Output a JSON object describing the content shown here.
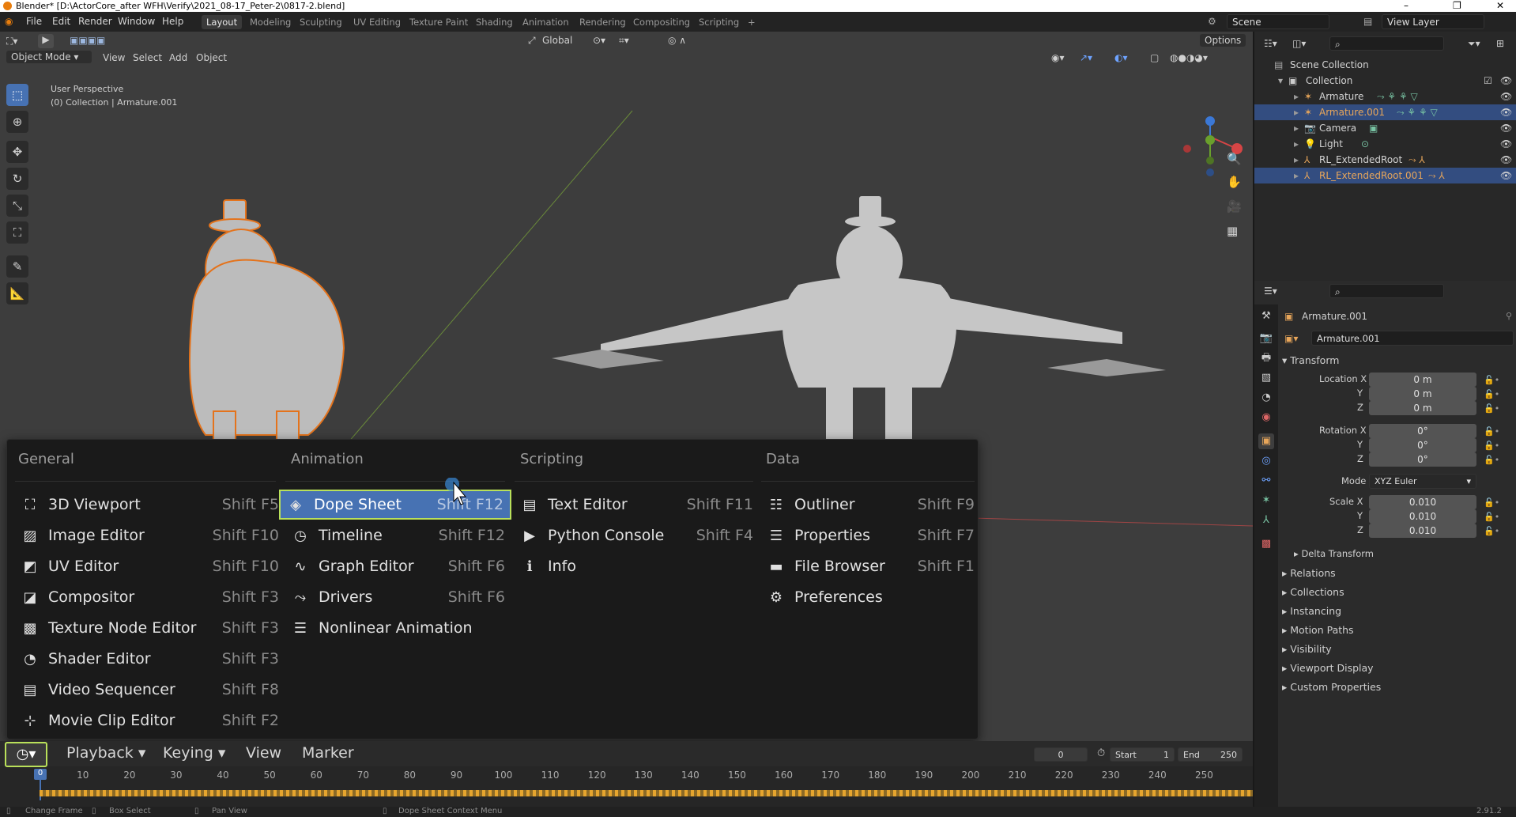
{
  "window": {
    "title": "Blender* [D:\\ActorCore_after WFH\\Verify\\2021_08-17_Peter-2\\0817-2.blend]",
    "controls": [
      "–",
      "❐",
      "✕"
    ]
  },
  "menubar": {
    "items": [
      "File",
      "Edit",
      "Render",
      "Window",
      "Help"
    ],
    "workspaces": [
      "Layout",
      "Modeling",
      "Sculpting",
      "UV Editing",
      "Texture Paint",
      "Shading",
      "Animation",
      "Rendering",
      "Compositing",
      "Scripting"
    ],
    "active_workspace": "Layout",
    "add_tab": "+",
    "scene": "Scene",
    "view_layer": "View Layer"
  },
  "viewport": {
    "mode": "Object Mode",
    "menu": [
      "View",
      "Select",
      "Add",
      "Object"
    ],
    "transform": "Global",
    "options": "Options",
    "perspective": "User Perspective",
    "context": "(0) Collection | Armature.001"
  },
  "editor_menu": {
    "columns": [
      {
        "heading": "General",
        "items": [
          {
            "label": "3D Viewport",
            "shortcut": "Shift F5",
            "icon": "viewport-icon"
          },
          {
            "label": "Image Editor",
            "shortcut": "Shift F10",
            "icon": "image-icon"
          },
          {
            "label": "UV Editor",
            "shortcut": "Shift F10",
            "icon": "uv-icon"
          },
          {
            "label": "Compositor",
            "shortcut": "Shift F3",
            "icon": "compositor-icon"
          },
          {
            "label": "Texture Node Editor",
            "shortcut": "Shift F3",
            "icon": "texture-icon"
          },
          {
            "label": "Shader Editor",
            "shortcut": "Shift F3",
            "icon": "shader-icon"
          },
          {
            "label": "Video Sequencer",
            "shortcut": "Shift F8",
            "icon": "sequencer-icon"
          },
          {
            "label": "Movie Clip Editor",
            "shortcut": "Shift F2",
            "icon": "clip-icon"
          }
        ]
      },
      {
        "heading": "Animation",
        "items": [
          {
            "label": "Dope Sheet",
            "shortcut": "Shift F12",
            "icon": "dopesheet-icon",
            "highlighted": true
          },
          {
            "label": "Timeline",
            "shortcut": "Shift F12",
            "icon": "timeline-icon"
          },
          {
            "label": "Graph Editor",
            "shortcut": "Shift F6",
            "icon": "graph-icon"
          },
          {
            "label": "Drivers",
            "shortcut": "Shift F6",
            "icon": "drivers-icon"
          },
          {
            "label": "Nonlinear Animation",
            "shortcut": "",
            "icon": "nla-icon"
          }
        ]
      },
      {
        "heading": "Scripting",
        "items": [
          {
            "label": "Text Editor",
            "shortcut": "Shift F11",
            "icon": "text-icon"
          },
          {
            "label": "Python Console",
            "shortcut": "Shift F4",
            "icon": "console-icon"
          },
          {
            "label": "Info",
            "shortcut": "",
            "icon": "info-icon"
          }
        ]
      },
      {
        "heading": "Data",
        "items": [
          {
            "label": "Outliner",
            "shortcut": "Shift F9",
            "icon": "outliner-icon"
          },
          {
            "label": "Properties",
            "shortcut": "Shift F7",
            "icon": "properties-icon"
          },
          {
            "label": "File Browser",
            "shortcut": "Shift F1",
            "icon": "folder-icon"
          },
          {
            "label": "Preferences",
            "shortcut": "",
            "icon": "gear-icon"
          }
        ]
      }
    ]
  },
  "timeline": {
    "menu": [
      "Playback",
      "Keying",
      "View",
      "Marker"
    ],
    "current_frame": "0",
    "start_label": "Start",
    "start": "1",
    "end_label": "End",
    "end": "250",
    "ticks": [
      "0",
      "10",
      "20",
      "30",
      "40",
      "50",
      "60",
      "70",
      "80",
      "90",
      "100",
      "110",
      "120",
      "130",
      "140",
      "150",
      "160",
      "170",
      "180",
      "190",
      "200",
      "210",
      "220",
      "230",
      "240",
      "250"
    ]
  },
  "statusbar": {
    "items": [
      "Change Frame",
      "Box Select",
      "Pan View",
      "Dope Sheet Context Menu"
    ],
    "version": "2.91.2"
  },
  "outliner": {
    "root": "Scene Collection",
    "collection": "Collection",
    "items": [
      {
        "name": "Armature",
        "selected": false
      },
      {
        "name": "Armature.001",
        "selected": true
      },
      {
        "name": "Camera",
        "selected": false
      },
      {
        "name": "Light",
        "selected": false
      },
      {
        "name": "RL_ExtendedRoot",
        "selected": false
      },
      {
        "name": "RL_ExtendedRoot.001",
        "selected": true
      }
    ]
  },
  "properties": {
    "object_name": "Armature.001",
    "data_name": "Armature.001",
    "transform_title": "Transform",
    "location": {
      "label": "Location X",
      "x": "0 m",
      "y": "0 m",
      "z": "0 m"
    },
    "rotation": {
      "label": "Rotation X",
      "x": "0°",
      "y": "0°",
      "z": "0°"
    },
    "mode_label": "Mode",
    "mode": "XYZ Euler",
    "scale": {
      "label": "Scale X",
      "x": "0.010",
      "y": "0.010",
      "z": "0.010"
    },
    "axis": {
      "y": "Y",
      "z": "Z"
    },
    "sections": [
      "Delta Transform",
      "Relations",
      "Collections",
      "Instancing",
      "Motion Paths",
      "Visibility",
      "Viewport Display",
      "Custom Properties"
    ]
  }
}
